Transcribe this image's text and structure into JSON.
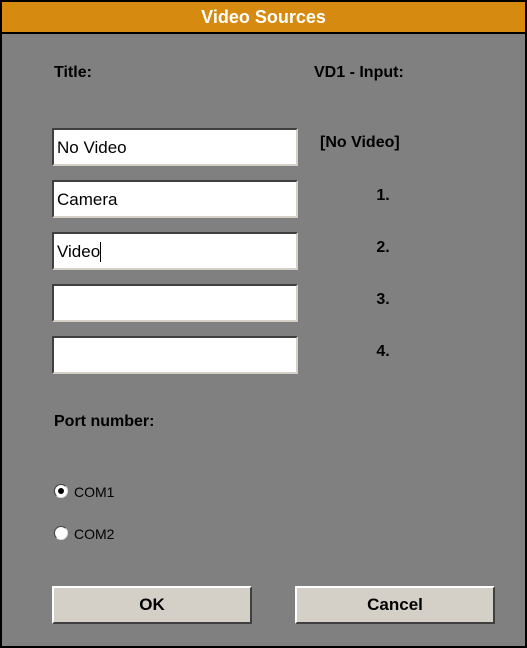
{
  "dialog": {
    "title": "Video Sources"
  },
  "labels": {
    "title_column": "Title:",
    "input_column": "VD1 - Input:",
    "port_number": "Port number:"
  },
  "sources": [
    {
      "title": "No Video",
      "input": "[No Video]"
    },
    {
      "title": "Camera",
      "input": "1."
    },
    {
      "title": "Video",
      "input": "2."
    },
    {
      "title": "",
      "input": "3."
    },
    {
      "title": "",
      "input": "4."
    }
  ],
  "ports": {
    "options": [
      "COM1",
      "COM2"
    ],
    "selected": "COM1"
  },
  "buttons": {
    "ok": "OK",
    "cancel": "Cancel"
  },
  "colors": {
    "titlebar": "#d68a10",
    "dialog_background": "#808080",
    "button_face": "#d4d0c8"
  }
}
